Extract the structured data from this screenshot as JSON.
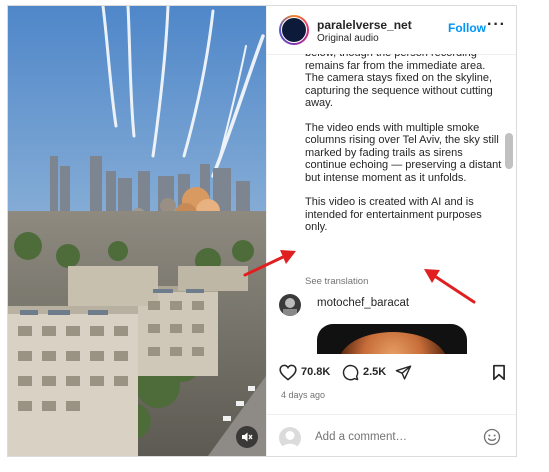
{
  "post": {
    "username": "paralelverse_net",
    "audio": "Original audio",
    "follow_label": "Follow",
    "more_label": "···"
  },
  "caption": {
    "paragraphs": [
      "below, though the person recording remains far from the immediate area. The camera stays fixed on the skyline, capturing the sequence without cutting away.",
      "The video ends with multiple smoke columns rising over Tel Aviv, the sky still marked by fading trails as sirens continue echoing — preserving a distant but intense moment as it unfolds.",
      "This video is created with AI and is intended for entertainment purposes only."
    ],
    "see_translation": "See translation"
  },
  "comment": {
    "username": "motochef_baracat"
  },
  "actions": {
    "likes": "70.8K",
    "comments": "2.5K"
  },
  "timestamp": "4 days ago",
  "add_comment_placeholder": "Add a comment…",
  "icons": {
    "heart": "heart-icon",
    "comment": "comment-icon",
    "share": "share-icon",
    "bookmark": "bookmark-icon",
    "emoji": "emoji-icon",
    "mute": "speaker-muted-icon"
  },
  "colors": {
    "accent": "#0095f6",
    "annotation_arrow": "#e02020"
  }
}
